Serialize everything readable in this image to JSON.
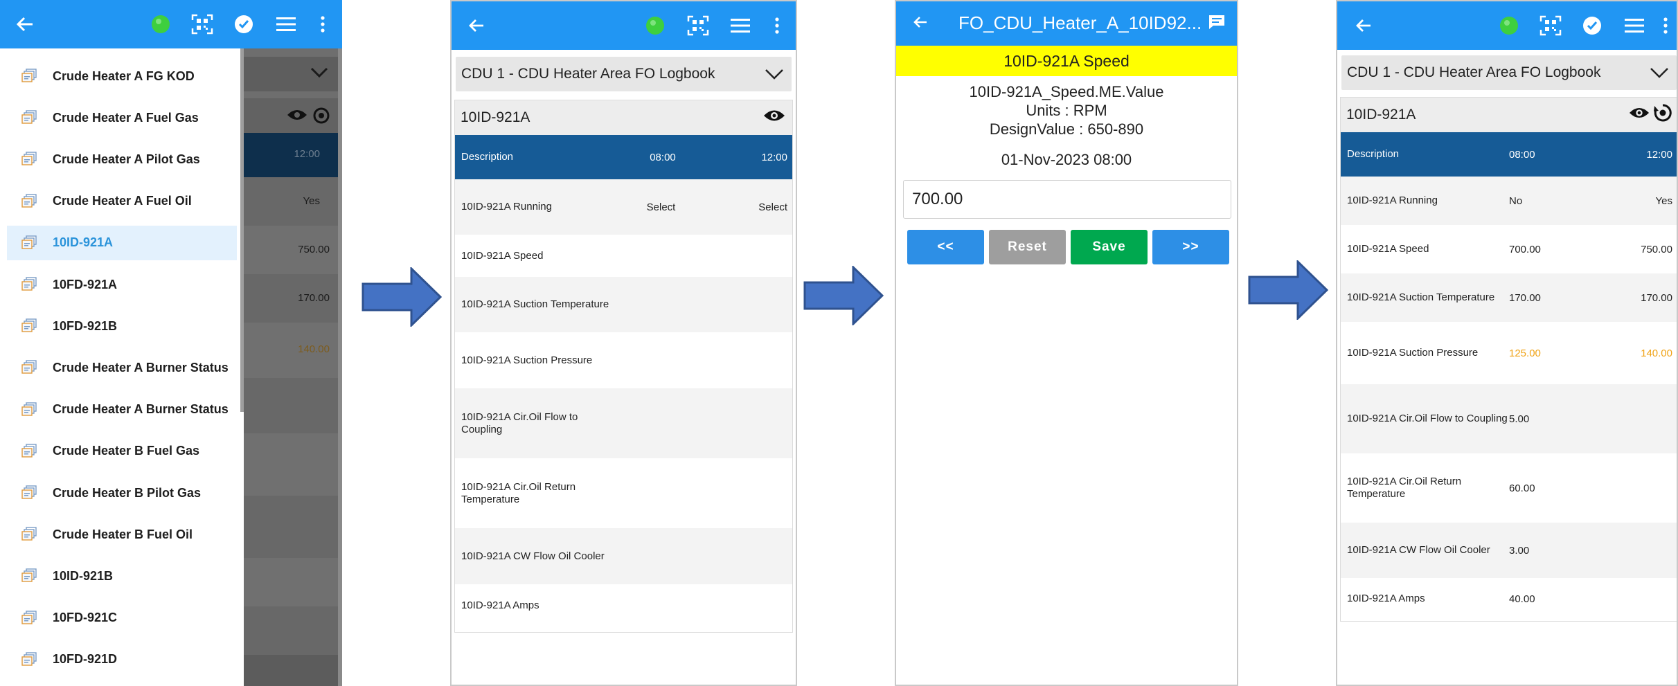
{
  "colors": {
    "appbar": "#2196f3",
    "table_header": "#165b96",
    "highlight_yellow": "#ffff00",
    "warning_text": "#f0a317",
    "save_button": "#00a84f",
    "nav_button": "#2d8fe6",
    "reset_button": "#9e9e9e"
  },
  "icons": {
    "back": "arrow-left",
    "status": "green-circle",
    "scan": "qr-code",
    "check": "check-circle",
    "menu": "hamburger",
    "more": "vertical-dots",
    "view": "eye",
    "sync": "sync-gear",
    "chevron": "chevron-down",
    "comment": "comment-bubble",
    "list_item": "document-stack",
    "flow": "right-arrow"
  },
  "panel1": {
    "drawer_items": [
      {
        "label": "Crude Heater A FG KOD",
        "selected": false
      },
      {
        "label": "Crude Heater A Fuel Gas",
        "selected": false
      },
      {
        "label": "Crude Heater A Pilot Gas",
        "selected": false
      },
      {
        "label": "Crude Heater A Fuel Oil",
        "selected": false
      },
      {
        "label": "10ID-921A",
        "selected": true
      },
      {
        "label": "10FD-921A",
        "selected": false
      },
      {
        "label": "10FD-921B",
        "selected": false
      },
      {
        "label": "Crude Heater A Burner Status",
        "selected": false
      },
      {
        "label": "Crude Heater A Burner Status",
        "selected": false
      },
      {
        "label": "Crude Heater B Fuel Gas",
        "selected": false
      },
      {
        "label": "Crude Heater B Pilot Gas",
        "selected": false
      },
      {
        "label": "Crude Heater B Fuel Oil",
        "selected": false
      },
      {
        "label": "10ID-921B",
        "selected": false
      },
      {
        "label": "10FD-921C",
        "selected": false
      },
      {
        "label": "10FD-921D",
        "selected": false
      }
    ],
    "background_values": [
      "12:00",
      "Yes",
      "750.00",
      "170.00",
      "140.00"
    ]
  },
  "panel2": {
    "logbook": "CDU 1 - CDU Heater Area FO Logbook",
    "equipment": "10ID-921A",
    "header": {
      "description": "Description",
      "t1": "08:00",
      "t2": "12:00"
    },
    "rows": [
      {
        "desc": "10ID-921A Running",
        "v1": "Select",
        "v2": "Select"
      },
      {
        "desc": "10ID-921A Speed",
        "v1": "",
        "v2": ""
      },
      {
        "desc": "10ID-921A Suction Temperature",
        "v1": "",
        "v2": ""
      },
      {
        "desc": "10ID-921A Suction Pressure",
        "v1": "",
        "v2": ""
      },
      {
        "desc": "10ID-921A Cir.Oil Flow to Coupling",
        "v1": "",
        "v2": ""
      },
      {
        "desc": "10ID-921A Cir.Oil Return Temperature",
        "v1": "",
        "v2": ""
      },
      {
        "desc": "10ID-921A CW Flow Oil Cooler",
        "v1": "",
        "v2": ""
      },
      {
        "desc": "10ID-921A Amps",
        "v1": "",
        "v2": ""
      }
    ]
  },
  "panel3": {
    "title": "FO_CDU_Heater_A_10ID92...",
    "param_name": "10ID-921A Speed",
    "tag": "10ID-921A_Speed.ME.Value",
    "units": "Units : RPM",
    "design_value": "DesignValue : 650-890",
    "datetime": "01-Nov-2023 08:00",
    "input_value": "700.00",
    "buttons": {
      "prev": "<<",
      "reset": "Reset",
      "save": "Save",
      "next": ">>"
    }
  },
  "panel4": {
    "logbook": "CDU 1 - CDU Heater Area FO Logbook",
    "equipment": "10ID-921A",
    "header": {
      "description": "Description",
      "t1": "08:00",
      "t2": "12:00"
    },
    "rows": [
      {
        "desc": "10ID-921A Running",
        "v1": "No",
        "v2": "Yes"
      },
      {
        "desc": "10ID-921A Speed",
        "v1": "700.00",
        "v2": "750.00"
      },
      {
        "desc": "10ID-921A Suction Temperature",
        "v1": "170.00",
        "v2": "170.00"
      },
      {
        "desc": "10ID-921A Suction Pressure",
        "v1": "125.00",
        "v2": "140.00"
      },
      {
        "desc": "10ID-921A Cir.Oil Flow to Coupling",
        "v1": "5.00",
        "v2": ""
      },
      {
        "desc": "10ID-921A Cir.Oil Return Temperature",
        "v1": "60.00",
        "v2": ""
      },
      {
        "desc": "10ID-921A CW Flow Oil Cooler",
        "v1": "3.00",
        "v2": ""
      },
      {
        "desc": "10ID-921A Amps",
        "v1": "40.00",
        "v2": ""
      }
    ]
  }
}
